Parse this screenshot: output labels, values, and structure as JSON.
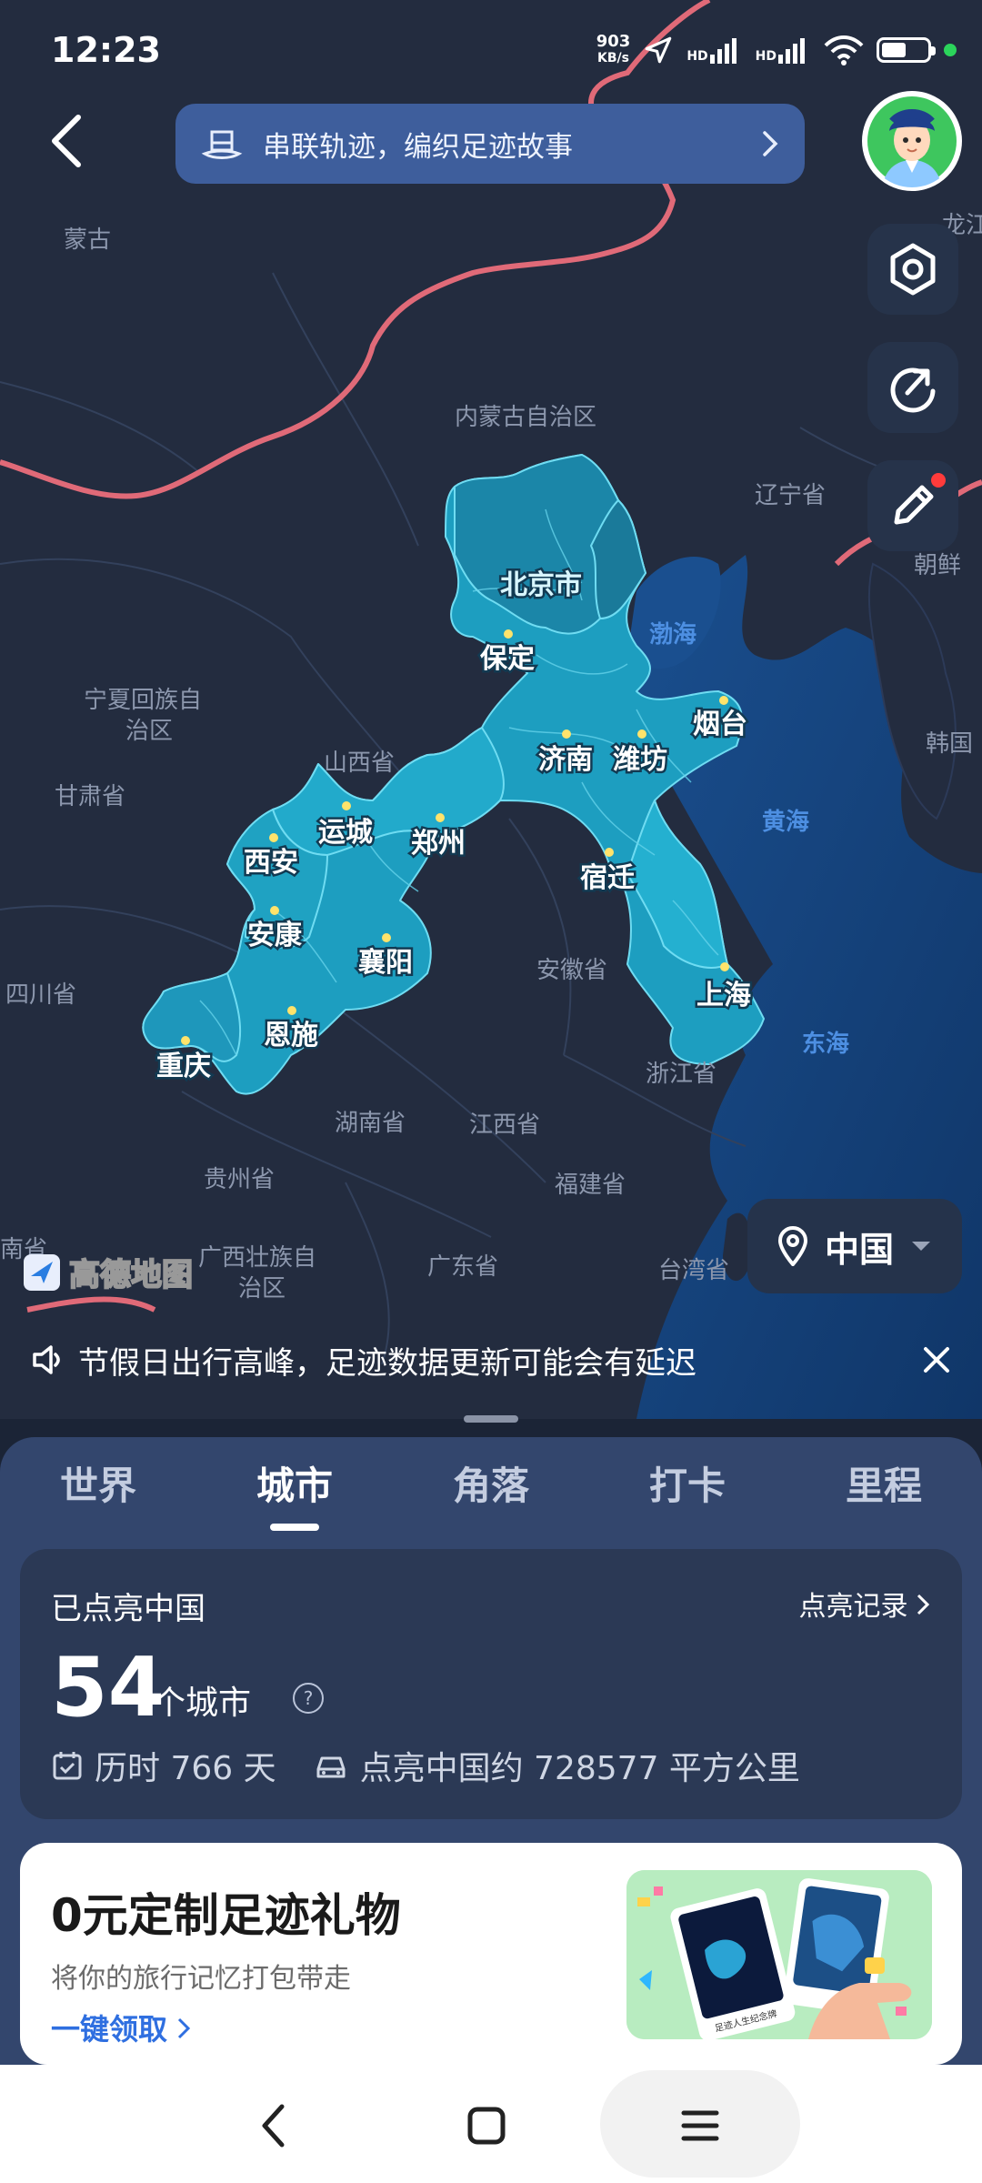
{
  "status_bar": {
    "time": "12:23",
    "speed": "903",
    "speed_unit": "KB/s",
    "signal1": "HD",
    "signal2": "HD",
    "battery_level": 0.55
  },
  "banner": {
    "text": "串联轨迹，编织足迹故事"
  },
  "map": {
    "regions": {
      "mongolia": "蒙古",
      "inner_mongolia": "内蒙古自治区",
      "liaoning": "辽宁省",
      "north_korea": "朝鲜",
      "korea": "韩国",
      "ningxia_1": "宁夏回族自",
      "ningxia_2": "治区",
      "gansu": "甘肃省",
      "shanxi": "山西省",
      "sichuan": "四川省",
      "anhui": "安徽省",
      "zhejiang": "浙江省",
      "hunan": "湖南省",
      "jiangxi": "江西省",
      "guizhou": "贵州省",
      "fujian": "福建省",
      "guangxi_1": "广西壮族自",
      "guangxi_2": "治区",
      "guangdong": "广东省",
      "taiwan": "台湾省",
      "yunnan_partial": "南省",
      "heilongjiang_partial": "龙江"
    },
    "seas": {
      "bohai": "渤海",
      "yellow_sea": "黄海",
      "east_sea": "东海"
    },
    "cities": {
      "beijing": "北京市",
      "baoding": "保定",
      "yantai": "烟台",
      "jinan": "济南",
      "weifang": "潍坊",
      "yuncheng": "运城",
      "zhengzhou": "郑州",
      "xian": "西安",
      "suqian": "宿迁",
      "ankang": "安康",
      "xiangyang": "襄阳",
      "shanghai": "上海",
      "enshi": "恩施",
      "chongqing": "重庆"
    },
    "logo_text": "高德地图",
    "country_selector": "中国"
  },
  "notice": {
    "text": "节假日出行高峰，足迹数据更新可能会有延迟"
  },
  "tabs": [
    {
      "label": "世界",
      "active": false
    },
    {
      "label": "城市",
      "active": true
    },
    {
      "label": "角落",
      "active": false
    },
    {
      "label": "打卡",
      "active": false
    },
    {
      "label": "里程",
      "active": false
    }
  ],
  "stats_card": {
    "title": "已点亮中国",
    "record_link": "点亮记录",
    "count": "54",
    "unit": "个城市",
    "days": "历时 766 天",
    "area": "点亮中国约 728577 平方公里"
  },
  "gift_card": {
    "title": "0元定制足迹礼物",
    "subtitle": "将你的旅行记忆打包带走",
    "action": "一键领取",
    "art_caption": "足迹人生纪念牌"
  },
  "colors": {
    "map_land": "#232c3f",
    "map_sea": "#153f78",
    "lit_region": "#1fa3c4",
    "border_red": "#e06a78",
    "accent_blue": "#2f6fe0"
  }
}
